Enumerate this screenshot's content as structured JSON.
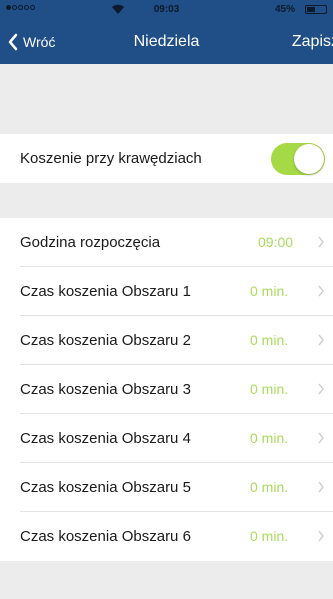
{
  "status_bar": {
    "time": "09:03",
    "battery_text": "45%",
    "battery_level": 0.45,
    "signal_dots": 5
  },
  "nav": {
    "back_label": "Wróć",
    "title": "Niedziela",
    "save_label": "Zapisz"
  },
  "edge_mowing": {
    "label": "Koszenie przy krawędziach",
    "enabled": true
  },
  "schedule": [
    {
      "label": "Godzina rozpoczęcia",
      "value": "09:00"
    },
    {
      "label": "Czas koszenia Obszaru 1",
      "value": "0 min."
    },
    {
      "label": "Czas koszenia Obszaru 2",
      "value": "0 min."
    },
    {
      "label": "Czas koszenia Obszaru 3",
      "value": "0 min."
    },
    {
      "label": "Czas koszenia Obszaru 4",
      "value": "0 min."
    },
    {
      "label": "Czas koszenia Obszaru 5",
      "value": "0 min."
    },
    {
      "label": "Czas koszenia Obszaru 6",
      "value": "0 min."
    }
  ],
  "colors": {
    "nav_bg": "#1f4f86",
    "accent_green": "#a8db5c",
    "toggle_on": "#a5d946",
    "background": "#ececec"
  }
}
